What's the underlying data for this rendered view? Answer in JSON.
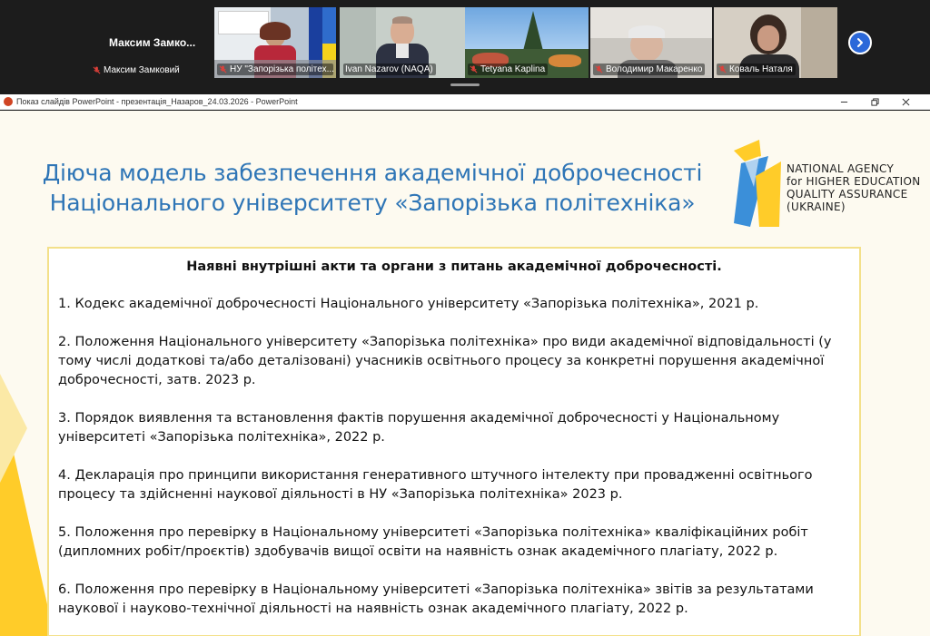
{
  "meeting": {
    "self": {
      "display_name": "Максим  Замко...",
      "label": "Максим Замковий"
    },
    "participants": [
      {
        "label": "НУ \"Запорізька політех...",
        "muted": true,
        "active": false
      },
      {
        "label": "Ivan Nazarov (NAQA)",
        "muted": false,
        "active": true
      },
      {
        "label": "Tetyana Kaplina",
        "muted": true,
        "active": false
      },
      {
        "label": "Володимир Макаренко",
        "muted": true,
        "active": false
      },
      {
        "label": "Коваль Наталя",
        "muted": true,
        "active": false
      }
    ],
    "colors": {
      "mic_muted": "#e0403a",
      "active_border": "#2ebd6b",
      "next_button": "#2b68d9"
    }
  },
  "window": {
    "title": "Показ слайдів PowerPoint  -  презентація_Назаров_24.03.2026 - PowerPoint",
    "icon": "powerpoint-icon"
  },
  "slide": {
    "title_line1": "Діюча модель забезпечення академічної доброчесності",
    "title_line2": "Національного університету «Запорізька політехніка»",
    "logo": {
      "line1": "NATIONAL AGENCY",
      "line2": "for HIGHER EDUCATION",
      "line3": "QUALITY ASSURANCE",
      "line4": "(UKRAINE)"
    },
    "box_heading": "Наявні внутрішні акти та органи з питань академічної доброчесності.",
    "items": [
      "1. Кодекс академічної доброчесності Національного університету «Запорізька політехніка», 2021 р.",
      "2. Положення Національного університету «Запорізька політехніка» про види академічної відповідальності (у тому числі додаткові та/або деталізовані) учасників освітнього процесу за конкретні порушення академічної доброчесності, затв. 2023 р.",
      "3. Порядок виявлення та встановлення фактів порушення академічної доброчесності у Національному університеті «Запорізька політехніка», 2022 р.",
      "4. Декларація про принципи використання генеративного штучного інтелекту при провадженні освітнього процесу та здійсненні наукової діяльності в НУ «Запорізька політехніка» 2023 р.",
      "5. Положення про перевірку в Національному університеті «Запорізька політехніка» кваліфікаційних робіт (дипломних робіт/проєктів) здобувачів вищої освіти на наявність ознак академічного плагіату, 2022 р.",
      "6. Положення про перевірку в Національному університеті «Запорізька політехніка» звітів за результатами наукової і науково-технічної діяльності на наявність ознак академічного плагіату, 2022 р."
    ],
    "colors": {
      "title": "#2e75b6",
      "box_border": "#f3e08a",
      "background": "#fdfaf0",
      "accent_yellow": "#ffcc29",
      "accent_blue": "#3b8fd9"
    }
  }
}
